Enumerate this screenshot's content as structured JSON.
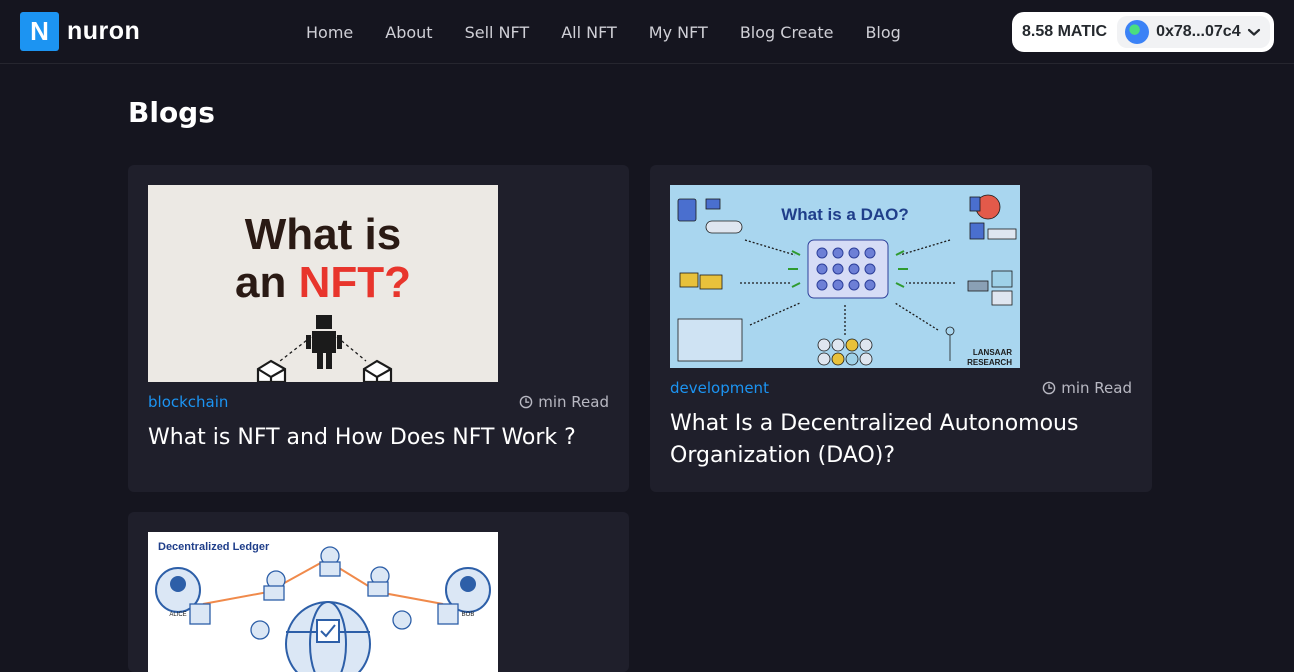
{
  "brand": {
    "mark": "N",
    "name": "nuron"
  },
  "nav": [
    "Home",
    "About",
    "Sell NFT",
    "All NFT",
    "My NFT",
    "Blog Create",
    "Blog"
  ],
  "wallet": {
    "balance": "8.58 MATIC",
    "address": "0x78...07c4"
  },
  "page": {
    "title": "Blogs"
  },
  "posts": [
    {
      "tag": "blockchain",
      "read": "min Read",
      "title": "What is NFT and How Does NFT Work ?",
      "image": {
        "line1": "What is",
        "line2_prefix": "an ",
        "line2_highlight": "NFT?"
      }
    },
    {
      "tag": "development",
      "read": "min Read",
      "title": "What Is a Decentralized Autonomous Organization (DAO)?",
      "image": {
        "heading": "What is a DAO?",
        "credit_1": "LANSAAR",
        "credit_2": "RESEARCH"
      }
    },
    {
      "image": {
        "heading": "Decentralized Ledger",
        "left_person": "ALICE",
        "right_person": "BOB"
      }
    }
  ],
  "colors": {
    "accent": "#1c94f2",
    "background": "#15151f",
    "card": "#1f1f2b",
    "nft_red": "#e8352c"
  }
}
